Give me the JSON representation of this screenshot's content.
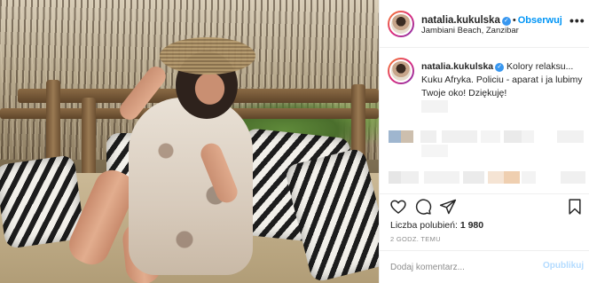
{
  "post": {
    "username": "natalia.kukulska",
    "follow_label": "Obserwuj",
    "location": "Jambiani Beach, Zanzibar",
    "more_label": "•••"
  },
  "caption": {
    "username": "natalia.kukulska",
    "text": "Kolory relaksu... Kuku Afryka. Policiu - aparat i ja lubimy Twoje oko! Dziękuję!"
  },
  "likes": {
    "label": "Liczba polubień:",
    "count": "1 980"
  },
  "timestamp": "2 GODZ. TEMU",
  "comment": {
    "placeholder": "Dodaj komentarz...",
    "publish_label": "Opublikuj"
  },
  "icons": {
    "like": "heart-icon",
    "comment": "comment-icon",
    "share": "share-icon",
    "save": "bookmark-icon",
    "verified": "verified-badge-icon"
  },
  "colors": {
    "accent": "#0095f6",
    "verified": "#3897f0",
    "muted": "#8e8e8e",
    "divider": "#efefef"
  }
}
